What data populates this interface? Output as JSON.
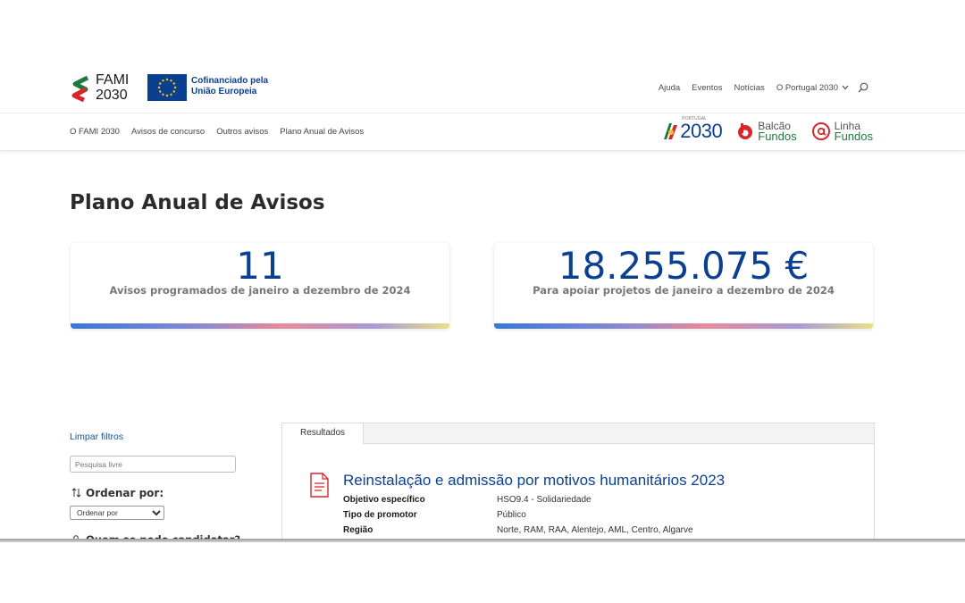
{
  "header": {
    "fami_name": "FAMI",
    "fami_year": "2030",
    "eu_text_line1": "Cofinanciado pela",
    "eu_text_line2": "União Europeia",
    "utility_nav": [
      "Ajuda",
      "Eventos",
      "Notícias",
      "O Portugal 2030"
    ],
    "search_icon": "search-icon"
  },
  "main_nav": {
    "items": [
      "O FAMI 2030",
      "Avisos de concurso",
      "Outros avisos",
      "Plano Anual de Avisos"
    ]
  },
  "partners": {
    "portugal2030_small": "PORTUGAL",
    "portugal2030_num": "2030",
    "balcao_l1": "Balcão",
    "balcao_l2": "Fundos",
    "linha_l1": "Linha",
    "linha_l2": "Fundos"
  },
  "page": {
    "title": "Plano Anual de Avisos"
  },
  "stats": [
    {
      "value": "11",
      "label": "Avisos programados de janeiro a dezembro de 2024"
    },
    {
      "value": "18.255.075 €",
      "label": "Para apoiar projetos de janeiro a dezembro de 2024"
    }
  ],
  "filters": {
    "clear_label": "Limpar filtros",
    "search_placeholder": "Pesquisa livre",
    "order_heading": "Ordenar por:",
    "order_select_value": "Ordenar por",
    "who_heading": "Quem se pode candidatar?"
  },
  "results": {
    "tab_label": "Resultados",
    "items": [
      {
        "title": "Reinstalação e admissão por motivos humanitários 2023",
        "fields": [
          {
            "key": "Objetivo específico",
            "value": "HSO9.4 - Solidariedade"
          },
          {
            "key": "Tipo de promotor",
            "value": "Público"
          },
          {
            "key": "Região",
            "value": "Norte, RAM, RAA, Alentejo, AML, Centro, Algarve"
          }
        ]
      }
    ]
  },
  "colors": {
    "brand_blue": "#0b3f8f",
    "link_blue": "#0b58a8",
    "green": "#1e7a3c"
  }
}
